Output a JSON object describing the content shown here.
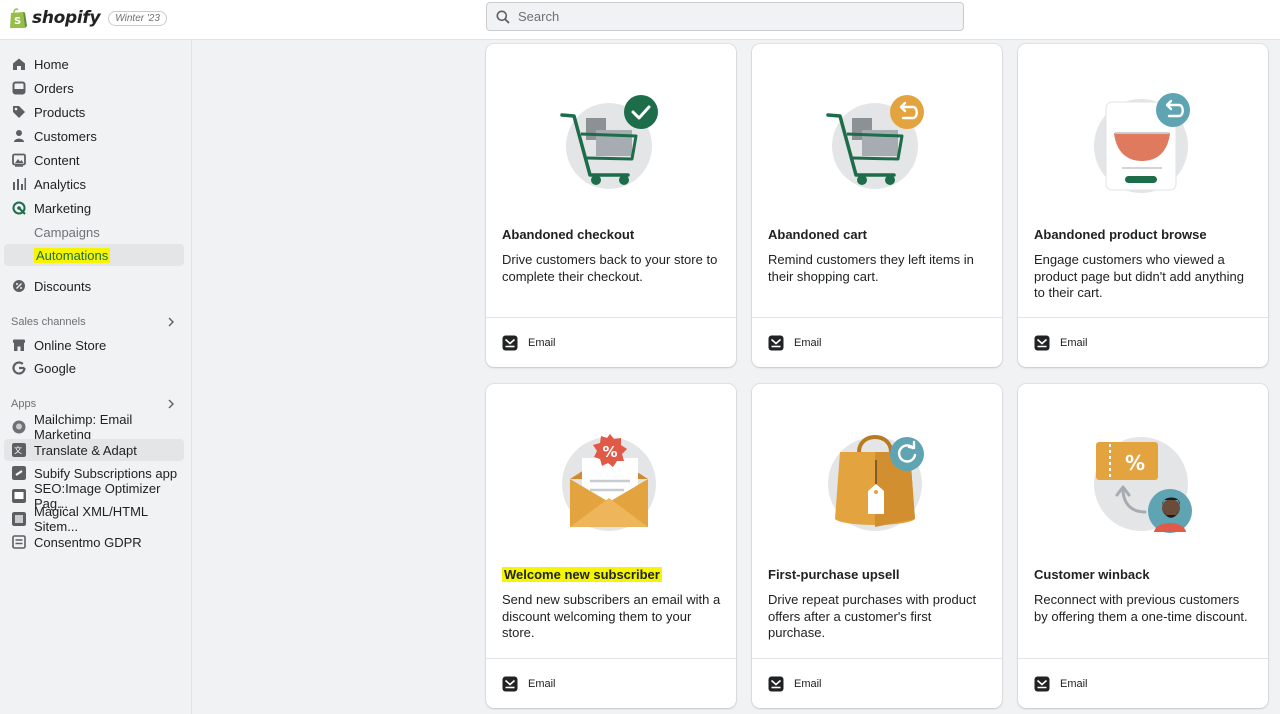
{
  "brand": {
    "name": "shopify",
    "edition": "Winter '23"
  },
  "search": {
    "placeholder": "Search"
  },
  "sidebar": {
    "items": [
      {
        "label": "Home",
        "icon": "home-icon"
      },
      {
        "label": "Orders",
        "icon": "inbox-icon"
      },
      {
        "label": "Products",
        "icon": "tag-icon"
      },
      {
        "label": "Customers",
        "icon": "person-icon"
      },
      {
        "label": "Content",
        "icon": "image-icon"
      },
      {
        "label": "Analytics",
        "icon": "bar-chart-icon"
      },
      {
        "label": "Marketing",
        "icon": "target-icon"
      }
    ],
    "marketing_sub": [
      {
        "label": "Campaigns"
      },
      {
        "label": "Automations"
      }
    ],
    "discounts": {
      "label": "Discounts",
      "icon": "discount-icon"
    },
    "sales_channels": {
      "heading": "Sales channels",
      "items": [
        {
          "label": "Online Store"
        },
        {
          "label": "Google"
        }
      ]
    },
    "apps": {
      "heading": "Apps",
      "items": [
        {
          "label": "Mailchimp: Email Marketing"
        },
        {
          "label": "Translate & Adapt"
        },
        {
          "label": "Subify Subscriptions app"
        },
        {
          "label": "SEO:Image Optimizer Pag..."
        },
        {
          "label": "Magical XML/HTML Sitem..."
        },
        {
          "label": "Consentmo GDPR"
        }
      ]
    }
  },
  "cards": [
    {
      "title": "Abandoned checkout",
      "desc": "Drive customers back to your store to complete their checkout.",
      "channel": "Email"
    },
    {
      "title": "Abandoned cart",
      "desc": "Remind customers they left items in their shopping cart.",
      "channel": "Email"
    },
    {
      "title": "Abandoned product browse",
      "desc": "Engage customers who viewed a product page but didn't add anything to their cart.",
      "channel": "Email"
    },
    {
      "title": "Welcome new subscriber",
      "desc": "Send new subscribers an email with a discount welcoming them to your store.",
      "channel": "Email"
    },
    {
      "title": "First-purchase upsell",
      "desc": "Drive repeat purchases with product offers after a customer's first purchase.",
      "channel": "Email"
    },
    {
      "title": "Customer winback",
      "desc": "Reconnect with previous customers by offering them a one-time discount.",
      "channel": "Email"
    }
  ],
  "colors": {
    "highlight": "#f5f500",
    "accent_green": "#1d6c4a",
    "orange": "#e3a33f",
    "teal": "#5fa4b3"
  }
}
